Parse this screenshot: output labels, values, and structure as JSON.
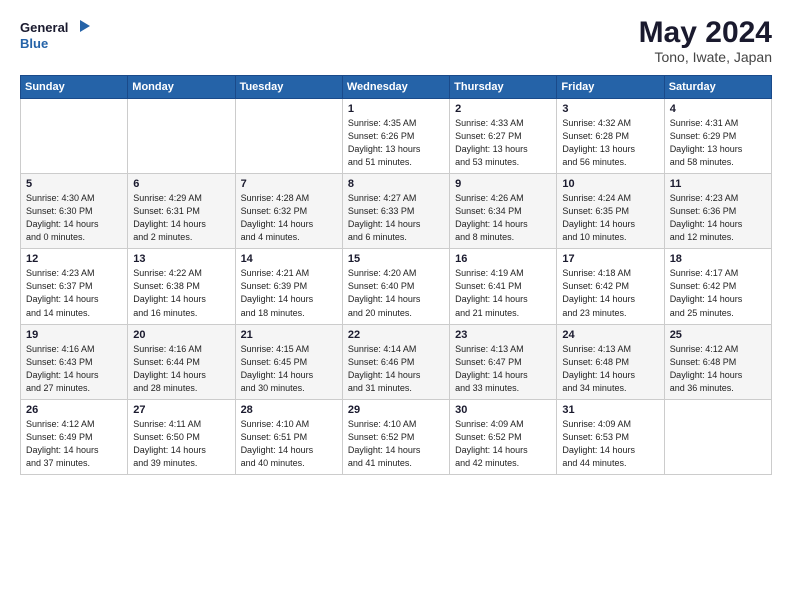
{
  "header": {
    "logo_line1": "General",
    "logo_line2": "Blue",
    "title": "May 2024",
    "subtitle": "Tono, Iwate, Japan"
  },
  "weekdays": [
    "Sunday",
    "Monday",
    "Tuesday",
    "Wednesday",
    "Thursday",
    "Friday",
    "Saturday"
  ],
  "weeks": [
    [
      {
        "day": "",
        "info": ""
      },
      {
        "day": "",
        "info": ""
      },
      {
        "day": "",
        "info": ""
      },
      {
        "day": "1",
        "info": "Sunrise: 4:35 AM\nSunset: 6:26 PM\nDaylight: 13 hours\nand 51 minutes."
      },
      {
        "day": "2",
        "info": "Sunrise: 4:33 AM\nSunset: 6:27 PM\nDaylight: 13 hours\nand 53 minutes."
      },
      {
        "day": "3",
        "info": "Sunrise: 4:32 AM\nSunset: 6:28 PM\nDaylight: 13 hours\nand 56 minutes."
      },
      {
        "day": "4",
        "info": "Sunrise: 4:31 AM\nSunset: 6:29 PM\nDaylight: 13 hours\nand 58 minutes."
      }
    ],
    [
      {
        "day": "5",
        "info": "Sunrise: 4:30 AM\nSunset: 6:30 PM\nDaylight: 14 hours\nand 0 minutes."
      },
      {
        "day": "6",
        "info": "Sunrise: 4:29 AM\nSunset: 6:31 PM\nDaylight: 14 hours\nand 2 minutes."
      },
      {
        "day": "7",
        "info": "Sunrise: 4:28 AM\nSunset: 6:32 PM\nDaylight: 14 hours\nand 4 minutes."
      },
      {
        "day": "8",
        "info": "Sunrise: 4:27 AM\nSunset: 6:33 PM\nDaylight: 14 hours\nand 6 minutes."
      },
      {
        "day": "9",
        "info": "Sunrise: 4:26 AM\nSunset: 6:34 PM\nDaylight: 14 hours\nand 8 minutes."
      },
      {
        "day": "10",
        "info": "Sunrise: 4:24 AM\nSunset: 6:35 PM\nDaylight: 14 hours\nand 10 minutes."
      },
      {
        "day": "11",
        "info": "Sunrise: 4:23 AM\nSunset: 6:36 PM\nDaylight: 14 hours\nand 12 minutes."
      }
    ],
    [
      {
        "day": "12",
        "info": "Sunrise: 4:23 AM\nSunset: 6:37 PM\nDaylight: 14 hours\nand 14 minutes."
      },
      {
        "day": "13",
        "info": "Sunrise: 4:22 AM\nSunset: 6:38 PM\nDaylight: 14 hours\nand 16 minutes."
      },
      {
        "day": "14",
        "info": "Sunrise: 4:21 AM\nSunset: 6:39 PM\nDaylight: 14 hours\nand 18 minutes."
      },
      {
        "day": "15",
        "info": "Sunrise: 4:20 AM\nSunset: 6:40 PM\nDaylight: 14 hours\nand 20 minutes."
      },
      {
        "day": "16",
        "info": "Sunrise: 4:19 AM\nSunset: 6:41 PM\nDaylight: 14 hours\nand 21 minutes."
      },
      {
        "day": "17",
        "info": "Sunrise: 4:18 AM\nSunset: 6:42 PM\nDaylight: 14 hours\nand 23 minutes."
      },
      {
        "day": "18",
        "info": "Sunrise: 4:17 AM\nSunset: 6:42 PM\nDaylight: 14 hours\nand 25 minutes."
      }
    ],
    [
      {
        "day": "19",
        "info": "Sunrise: 4:16 AM\nSunset: 6:43 PM\nDaylight: 14 hours\nand 27 minutes."
      },
      {
        "day": "20",
        "info": "Sunrise: 4:16 AM\nSunset: 6:44 PM\nDaylight: 14 hours\nand 28 minutes."
      },
      {
        "day": "21",
        "info": "Sunrise: 4:15 AM\nSunset: 6:45 PM\nDaylight: 14 hours\nand 30 minutes."
      },
      {
        "day": "22",
        "info": "Sunrise: 4:14 AM\nSunset: 6:46 PM\nDaylight: 14 hours\nand 31 minutes."
      },
      {
        "day": "23",
        "info": "Sunrise: 4:13 AM\nSunset: 6:47 PM\nDaylight: 14 hours\nand 33 minutes."
      },
      {
        "day": "24",
        "info": "Sunrise: 4:13 AM\nSunset: 6:48 PM\nDaylight: 14 hours\nand 34 minutes."
      },
      {
        "day": "25",
        "info": "Sunrise: 4:12 AM\nSunset: 6:48 PM\nDaylight: 14 hours\nand 36 minutes."
      }
    ],
    [
      {
        "day": "26",
        "info": "Sunrise: 4:12 AM\nSunset: 6:49 PM\nDaylight: 14 hours\nand 37 minutes."
      },
      {
        "day": "27",
        "info": "Sunrise: 4:11 AM\nSunset: 6:50 PM\nDaylight: 14 hours\nand 39 minutes."
      },
      {
        "day": "28",
        "info": "Sunrise: 4:10 AM\nSunset: 6:51 PM\nDaylight: 14 hours\nand 40 minutes."
      },
      {
        "day": "29",
        "info": "Sunrise: 4:10 AM\nSunset: 6:52 PM\nDaylight: 14 hours\nand 41 minutes."
      },
      {
        "day": "30",
        "info": "Sunrise: 4:09 AM\nSunset: 6:52 PM\nDaylight: 14 hours\nand 42 minutes."
      },
      {
        "day": "31",
        "info": "Sunrise: 4:09 AM\nSunset: 6:53 PM\nDaylight: 14 hours\nand 44 minutes."
      },
      {
        "day": "",
        "info": ""
      }
    ]
  ]
}
